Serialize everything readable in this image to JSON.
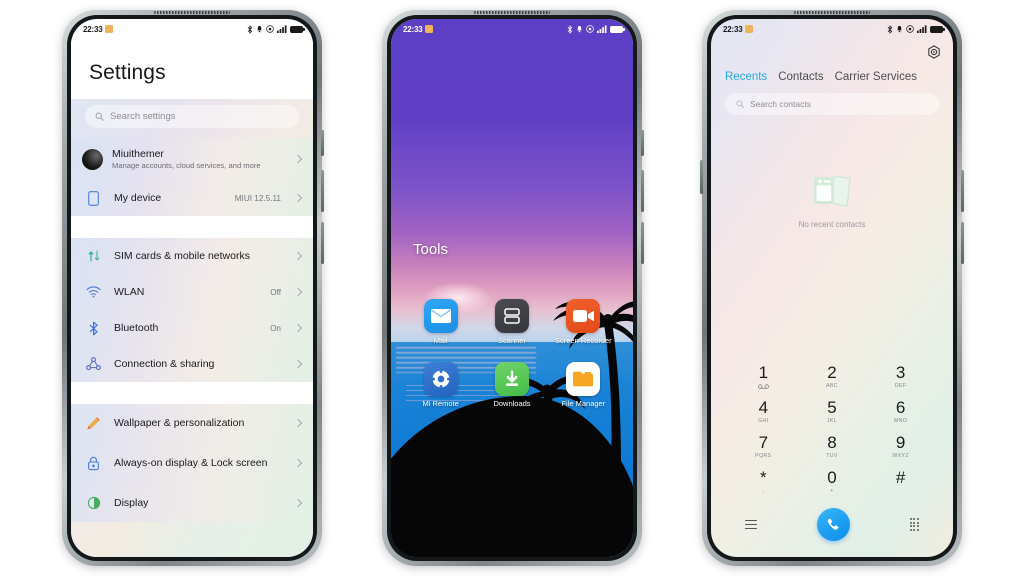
{
  "statusbar": {
    "time": "22:33",
    "icons": [
      "bluetooth-icon",
      "vibrate-icon",
      "dnd-icon",
      "signal-icon",
      "battery-icon"
    ]
  },
  "settings_phone": {
    "title": "Settings",
    "search": {
      "placeholder": "Search settings",
      "icon": "search-icon"
    },
    "account": {
      "name": "Miuithemer",
      "subtitle": "Manage accounts, cloud services, and more",
      "avatar": "avatar"
    },
    "device": {
      "label": "My device",
      "value": "MIUI 12.5.11",
      "icon": "phone-icon"
    },
    "group_network": [
      {
        "label": "SIM cards & mobile networks",
        "value": "",
        "icon": "sim-swap-icon"
      },
      {
        "label": "WLAN",
        "value": "Off",
        "icon": "wifi-icon"
      },
      {
        "label": "Bluetooth",
        "value": "On",
        "icon": "bluetooth-icon"
      },
      {
        "label": "Connection & sharing",
        "value": "",
        "icon": "share-icon"
      }
    ],
    "group_personalization": [
      {
        "label": "Wallpaper & personalization",
        "value": "",
        "icon": "brush-icon"
      },
      {
        "label": "Always-on display & Lock screen",
        "value": "",
        "icon": "lock-icon"
      },
      {
        "label": "Display",
        "value": "",
        "icon": "brightness-icon"
      }
    ]
  },
  "home_phone": {
    "folder_title": "Tools",
    "apps": [
      {
        "label": "Mail",
        "icon": "mail-icon"
      },
      {
        "label": "Scanner",
        "icon": "scanner-icon"
      },
      {
        "label": "Screen Recorder",
        "icon": "screen-recorder-icon"
      },
      {
        "label": "Mi Remote",
        "icon": "mi-remote-icon"
      },
      {
        "label": "Downloads",
        "icon": "download-icon"
      },
      {
        "label": "File Manager",
        "icon": "folder-icon"
      }
    ]
  },
  "dialer_phone": {
    "gear": "gear-icon",
    "tabs": [
      {
        "label": "Recents",
        "active": true
      },
      {
        "label": "Contacts",
        "active": false
      },
      {
        "label": "Carrier Services",
        "active": false
      }
    ],
    "search": {
      "placeholder": "Search contacts",
      "icon": "search-icon"
    },
    "empty_state": {
      "text": "No recent contacts",
      "icon": "contact-cards-icon"
    },
    "keys": [
      {
        "num": "1",
        "sub": "",
        "voicemail": true
      },
      {
        "num": "2",
        "sub": "ABC"
      },
      {
        "num": "3",
        "sub": "DEF"
      },
      {
        "num": "4",
        "sub": "GHI"
      },
      {
        "num": "5",
        "sub": "JKL"
      },
      {
        "num": "6",
        "sub": "MNO"
      },
      {
        "num": "7",
        "sub": "PQRS"
      },
      {
        "num": "8",
        "sub": "TUV"
      },
      {
        "num": "9",
        "sub": "WXYZ"
      },
      {
        "num": "*",
        "sub": ","
      },
      {
        "num": "0",
        "sub": "+"
      },
      {
        "num": "#",
        "sub": ""
      }
    ],
    "actions": {
      "menu": "menu-icon",
      "call": "call-icon",
      "keypad": "keypad-icon"
    },
    "accent_color": "#2aa7e8",
    "call_button_color": "#1c9ef2"
  }
}
